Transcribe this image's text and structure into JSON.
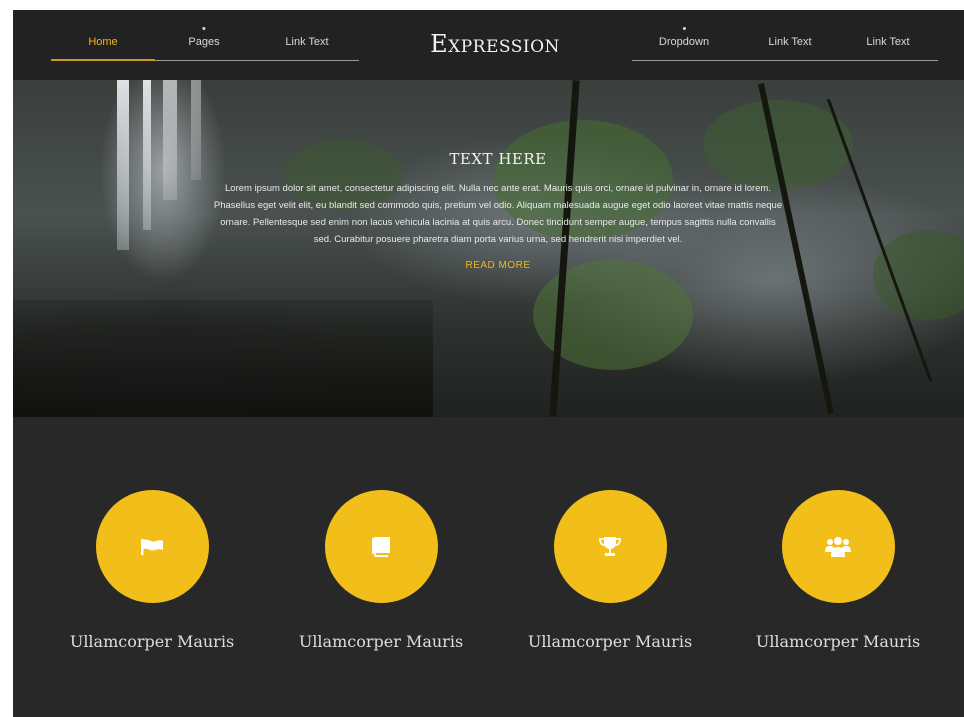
{
  "nav": {
    "left": [
      {
        "label": "Home",
        "active": true
      },
      {
        "label": "Pages",
        "has_dropdown": true
      },
      {
        "label": "Link Text"
      }
    ],
    "brand": "Expression",
    "right": [
      {
        "label": "Dropdown",
        "has_dropdown": true
      },
      {
        "label": "Link Text"
      },
      {
        "label": "Link Text"
      }
    ]
  },
  "hero": {
    "title": "TEXT HERE",
    "body": "Lorem ipsum dolor sit amet, consectetur adipiscing elit. Nulla nec ante erat. Mauris quis orci, ornare id pulvinar in, ornare id lorem. Phasellus eget velit elit, eu blandit sed commodo quis, pretium vel odio. Aliquam malesuada augue eget odio laoreet vitae mattis neque ornare. Pellentesque sed enim non lacus vehicula lacinia at quis arcu. Donec tincidunt semper augue, tempus sagittis nulla convallis sed. Curabitur posuere pharetra diam porta varius urna, sed hendrerit nisi imperdiet vel.",
    "cta": "READ MORE"
  },
  "features": [
    {
      "icon": "flag-icon",
      "title": "Ullamcorper Mauris"
    },
    {
      "icon": "book-icon",
      "title": "Ullamcorper Mauris"
    },
    {
      "icon": "trophy-icon",
      "title": "Ullamcorper Mauris"
    },
    {
      "icon": "users-icon",
      "title": "Ullamcorper Mauris"
    }
  ],
  "colors": {
    "accent": "#f2be1a",
    "background": "#282828",
    "nav_background": "#222222"
  }
}
